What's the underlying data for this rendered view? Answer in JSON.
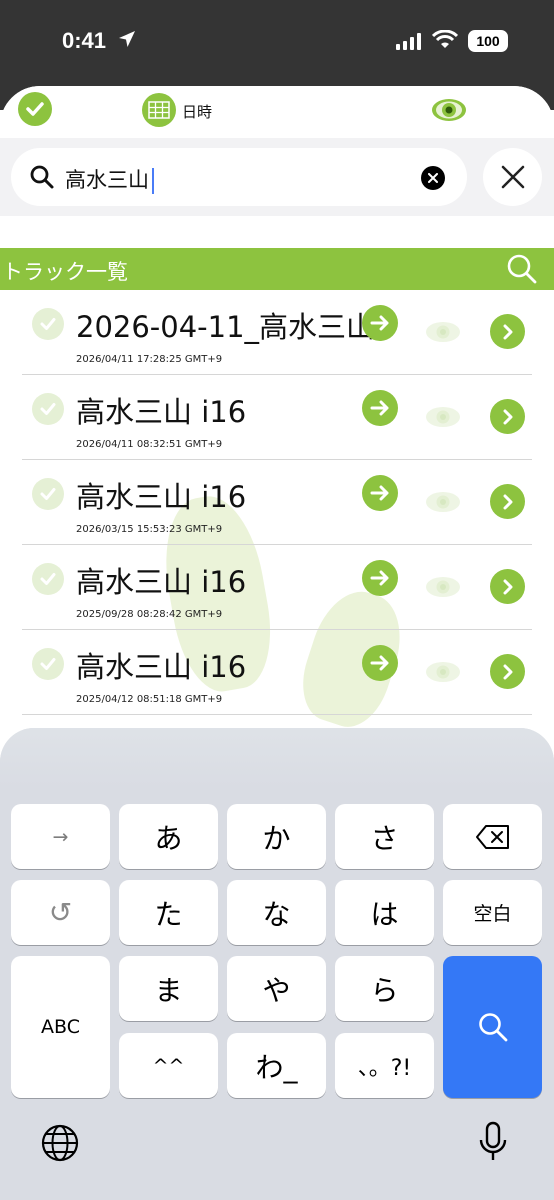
{
  "status_bar": {
    "time": "0:41",
    "battery": "100"
  },
  "toolbar": {
    "sort_label": "日時"
  },
  "search": {
    "query": "高水三山"
  },
  "list_header": {
    "title": "トラック一覧"
  },
  "tracks": [
    {
      "name": "2026-04-11_高水三山",
      "date": "2026/04/11 17:28:25 GMT+9"
    },
    {
      "name": "高水三山 i16",
      "date": "2026/04/11 08:32:51 GMT+9"
    },
    {
      "name": "高水三山 i16",
      "date": "2026/03/15 15:53:23 GMT+9"
    },
    {
      "name": "高水三山 i16",
      "date": "2025/09/28 08:28:42 GMT+9"
    },
    {
      "name": "高水三山 i16",
      "date": "2025/04/12 08:51:18 GMT+9"
    }
  ],
  "keyboard": {
    "next_key": "→",
    "undo_key": "↺",
    "row1": [
      "あ",
      "か",
      "さ"
    ],
    "row2": [
      "た",
      "な",
      "は"
    ],
    "space_key": "空白",
    "abc_key": "ABC",
    "row3": [
      "ま",
      "や",
      "ら"
    ],
    "row4": [
      "^^",
      "わ_",
      "、。?!"
    ]
  },
  "colors": {
    "accent": "#8dc33f",
    "search_key": "#3478f6"
  }
}
